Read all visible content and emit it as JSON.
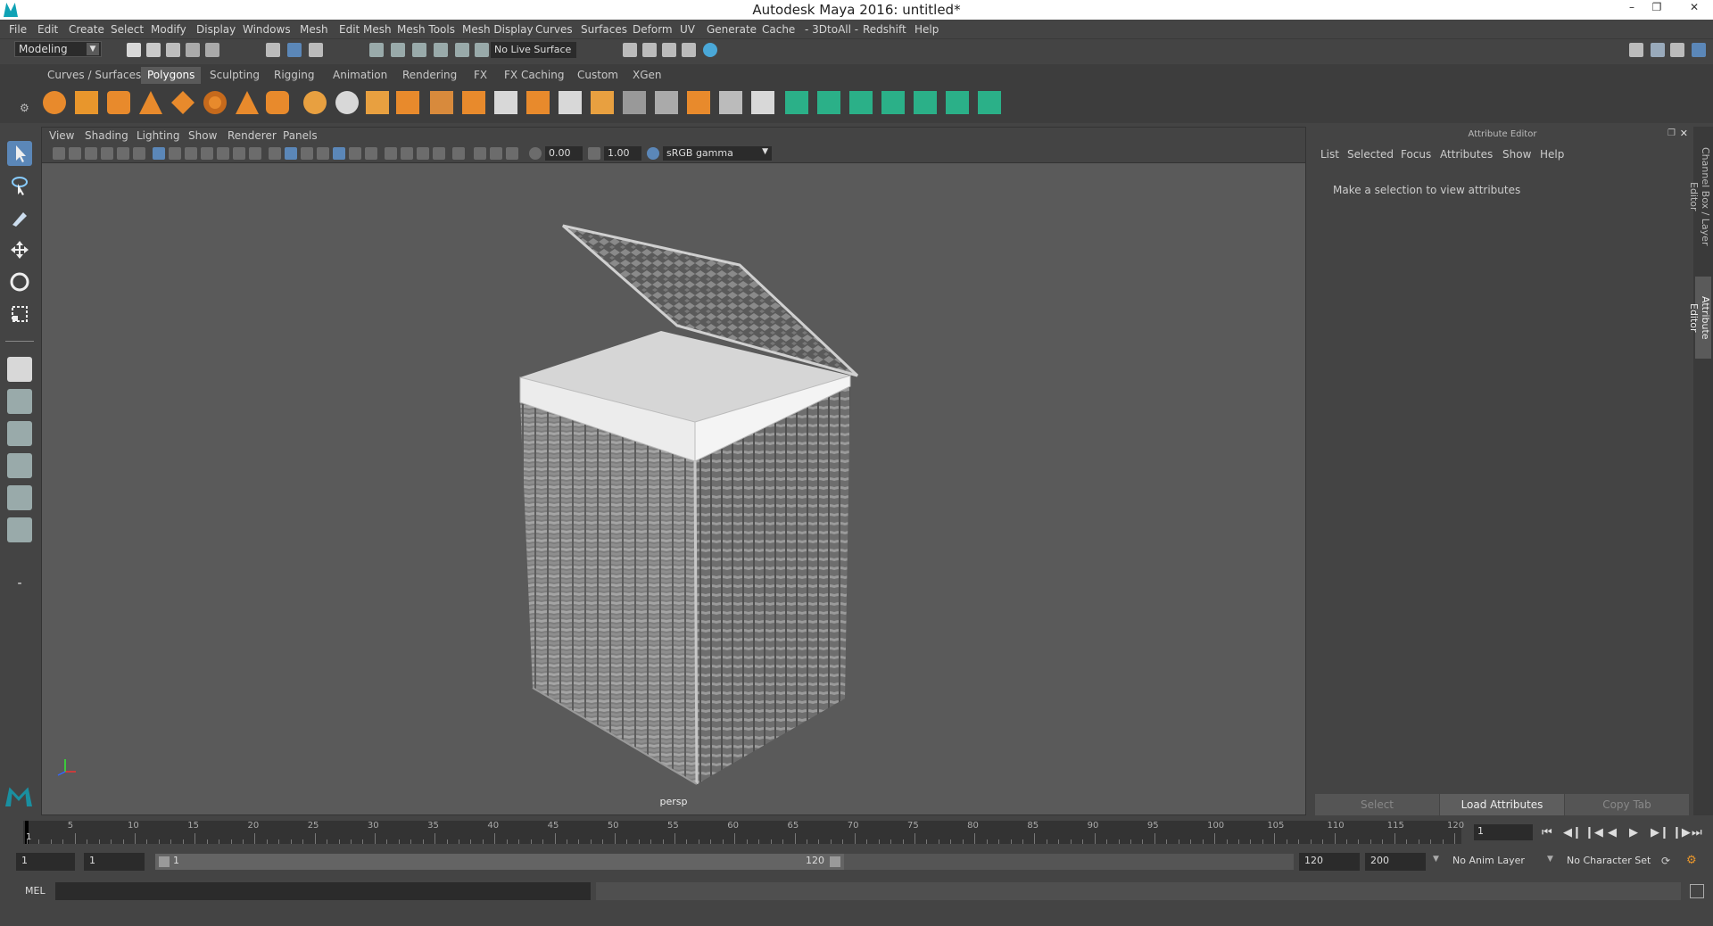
{
  "window": {
    "title": "Autodesk Maya 2016: untitled*"
  },
  "menu": [
    "File",
    "Edit",
    "Create",
    "Select",
    "Modify",
    "Display",
    "Windows",
    "Mesh",
    "Edit Mesh",
    "Mesh Tools",
    "Mesh Display",
    "Curves",
    "Surfaces",
    "Deform",
    "UV",
    "Generate",
    "Cache",
    "- 3DtoAll -",
    "Redshift",
    "Help"
  ],
  "toolbar": {
    "mode": "Modeling",
    "live_surface": "No Live Surface"
  },
  "shelf_tabs": [
    "Curves / Surfaces",
    "Polygons",
    "Sculpting",
    "Rigging",
    "Animation",
    "Rendering",
    "FX",
    "FX Caching",
    "Custom",
    "XGen"
  ],
  "shelf_active": "Polygons",
  "viewport": {
    "menu": [
      "View",
      "Shading",
      "Lighting",
      "Show",
      "Renderer",
      "Panels"
    ],
    "exposure": "0.00",
    "gamma": "1.00",
    "color_space": "sRGB gamma",
    "camera": "persp"
  },
  "attribute_editor": {
    "title": "Attribute Editor",
    "menu": [
      "List",
      "Selected",
      "Focus",
      "Attributes",
      "Show",
      "Help"
    ],
    "message": "Make a selection to view attributes",
    "buttons": [
      "Select",
      "Load Attributes",
      "Copy Tab"
    ]
  },
  "side_tabs": [
    "Channel Box / Layer Editor",
    "Attribute Editor"
  ],
  "timeline": {
    "ticks": [
      "5",
      "10",
      "15",
      "20",
      "25",
      "30",
      "35",
      "40",
      "45",
      "50",
      "55",
      "60",
      "65",
      "70",
      "75",
      "80",
      "85",
      "90",
      "95",
      "100",
      "105",
      "110",
      "115",
      "120"
    ],
    "start_label": "1",
    "current_frame": "1"
  },
  "range": {
    "start": "1",
    "start2": "1",
    "slider_start": "1",
    "slider_end": "120",
    "end": "120",
    "end2": "200",
    "anim_layer": "No Anim Layer",
    "character_set": "No Character Set"
  },
  "command": {
    "language": "MEL"
  }
}
